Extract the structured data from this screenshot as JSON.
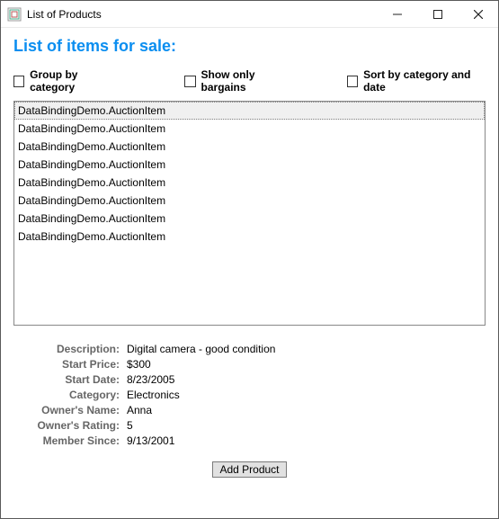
{
  "window": {
    "title": "List of Products"
  },
  "heading": "List of items for sale:",
  "filters": {
    "group_by_category": {
      "label": "Group by category",
      "checked": false
    },
    "show_only_bargains": {
      "label": "Show only bargains",
      "checked": false
    },
    "sort_by_category_date": {
      "label": "Sort by category and date",
      "checked": false
    }
  },
  "list": {
    "items": [
      "DataBindingDemo.AuctionItem",
      "DataBindingDemo.AuctionItem",
      "DataBindingDemo.AuctionItem",
      "DataBindingDemo.AuctionItem",
      "DataBindingDemo.AuctionItem",
      "DataBindingDemo.AuctionItem",
      "DataBindingDemo.AuctionItem",
      "DataBindingDemo.AuctionItem"
    ],
    "selected_index": 0
  },
  "details": {
    "labels": {
      "description": "Description:",
      "start_price": "Start Price:",
      "start_date": "Start Date:",
      "category": "Category:",
      "owner_name": "Owner's Name:",
      "owner_rating": "Owner's Rating:",
      "member_since": "Member Since:"
    },
    "values": {
      "description": "Digital camera - good condition",
      "start_price": "$300",
      "start_date": "8/23/2005",
      "category": "Electronics",
      "owner_name": "Anna",
      "owner_rating": "5",
      "member_since": "9/13/2001"
    }
  },
  "buttons": {
    "add_product": "Add Product"
  }
}
